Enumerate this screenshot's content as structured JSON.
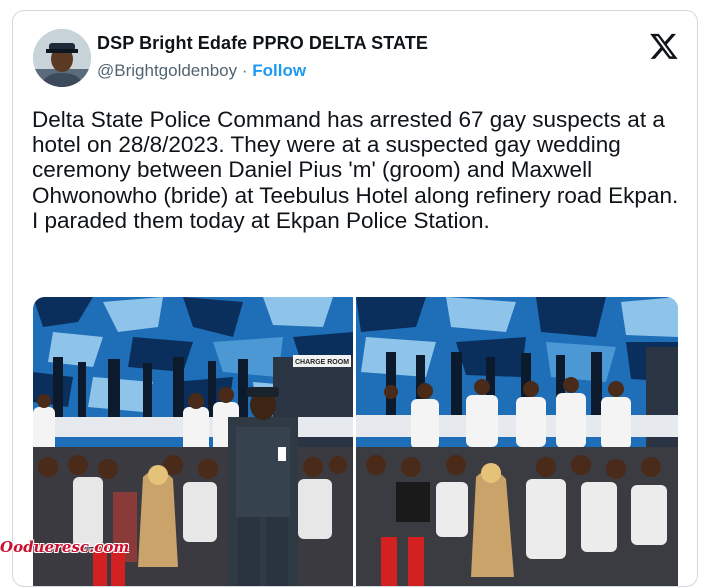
{
  "tweet": {
    "author_name": "DSP Bright Edafe PPRO DELTA STATE",
    "handle": "@Brightgoldenboy",
    "separator": "·",
    "follow_label": "Follow",
    "text": "Delta State Police Command has arrested 67 gay suspects at a hotel on 28/8/2023. They were at a suspected gay wedding ceremony between Daniel Pius 'm' (groom) and Maxwell Ohwonowho (bride) at Teebulus Hotel along refinery road Ekpan. I paraded them today at Ekpan Police Station."
  },
  "icons": {
    "brand": "x-logo-icon"
  },
  "photos": {
    "left_sign": "CHARGE ROOM",
    "watermark": "Oodueresc.com"
  },
  "colors": {
    "link": "#1d9bf0",
    "secondary_text": "#536471",
    "camo_base": "#1e6fb8",
    "border": "#cfd9de"
  }
}
